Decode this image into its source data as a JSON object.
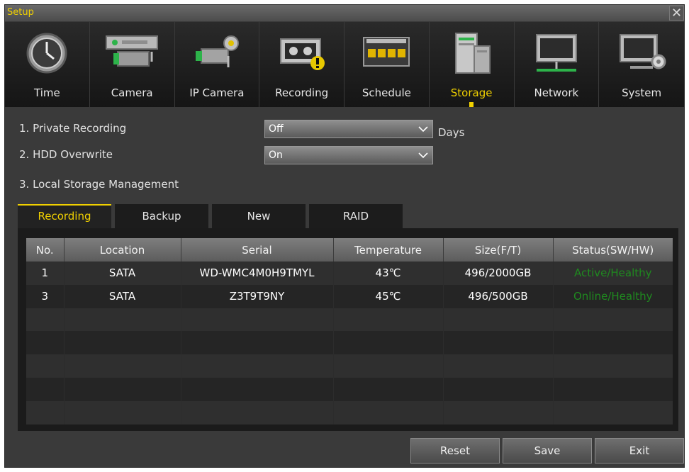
{
  "window": {
    "title": "Setup",
    "close_glyph": "✕"
  },
  "tabs": [
    {
      "label": "Time",
      "icon": "clock-icon"
    },
    {
      "label": "Camera",
      "icon": "camera-icon"
    },
    {
      "label": "IP Camera",
      "icon": "ip-camera-icon"
    },
    {
      "label": "Recording",
      "icon": "recording-icon"
    },
    {
      "label": "Schedule",
      "icon": "schedule-icon"
    },
    {
      "label": "Storage",
      "icon": "storage-icon",
      "active": true
    },
    {
      "label": "Network",
      "icon": "network-icon"
    },
    {
      "label": "System",
      "icon": "system-icon"
    }
  ],
  "form": {
    "private_recording_label": "1. Private Recording",
    "private_recording_value": "Off",
    "private_recording_unit": "Days",
    "hdd_overwrite_label": "2. HDD Overwrite",
    "hdd_overwrite_value": "On",
    "local_storage_label": "3. Local Storage Management"
  },
  "subtabs": [
    "Recording",
    "Backup",
    "New",
    "RAID"
  ],
  "table": {
    "headers": [
      "No.",
      "Location",
      "Serial",
      "Temperature",
      "Size(F/T)",
      "Status(SW/HW)"
    ],
    "rows": [
      [
        "1",
        "SATA",
        "WD-WMC4M0H9TMYL",
        "43℃",
        "496/2000GB",
        "Active/Healthy"
      ],
      [
        "3",
        "SATA",
        "Z3T9T9NY",
        "45℃",
        "496/500GB",
        "Online/Healthy"
      ]
    ]
  },
  "buttons": {
    "reset": "Reset",
    "save": "Save",
    "exit": "Exit"
  },
  "colors": {
    "accent": "#f0d000",
    "status_ok": "#1f8a1f"
  }
}
